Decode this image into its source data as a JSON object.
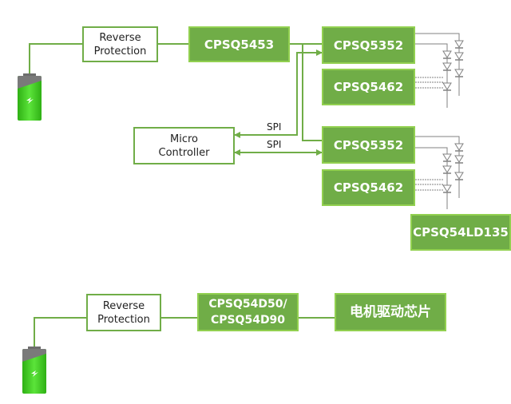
{
  "colors": {
    "accent_fill": "#70ad47",
    "accent_border": "#92d050",
    "line": "#70ad47",
    "led_line": "#808080",
    "battery_green": "#3ec31a",
    "battery_cap": "#7a7a7a"
  },
  "top": {
    "reverse_protection": "Reverse\nProtection",
    "regulator": "CPSQ5453",
    "driver1": "CPSQ5352",
    "driver1_aux": "CPSQ5462",
    "micro_controller": "Micro\nController",
    "spi_label_1": "SPI",
    "spi_label_2": "SPI",
    "driver2": "CPSQ5352",
    "driver2_aux": "CPSQ5462",
    "led_driver": "CPSQ54LD135"
  },
  "bottom": {
    "reverse_protection": "Reverse\nProtection",
    "regulator": "CPSQ54D50/\nCPSQ54D90",
    "motor_driver": "电机驱动芯片"
  },
  "icons": {
    "battery_top": "battery-icon",
    "battery_bottom": "battery-icon",
    "led_string": "diode-icon"
  }
}
